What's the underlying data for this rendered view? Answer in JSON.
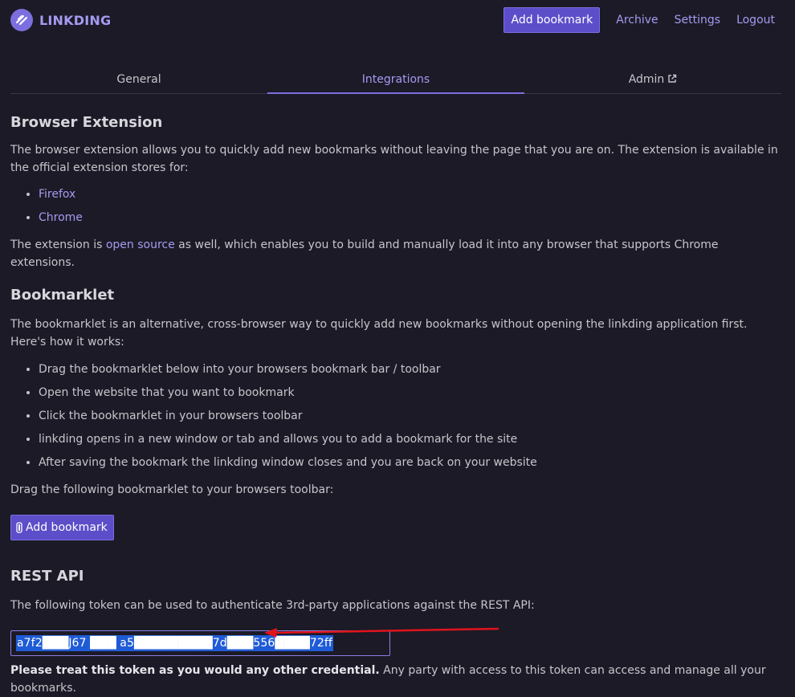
{
  "header": {
    "brand": "LINKDING",
    "add_bookmark_label": "Add bookmark",
    "nav": [
      {
        "label": "Archive"
      },
      {
        "label": "Settings"
      },
      {
        "label": "Logout"
      }
    ]
  },
  "tabs": [
    {
      "label": "General",
      "active": false
    },
    {
      "label": "Integrations",
      "active": true
    },
    {
      "label": "Admin",
      "active": false,
      "icon": "external-link-icon"
    }
  ],
  "browser_extension": {
    "title": "Browser Extension",
    "description": "The browser extension allows you to quickly add new bookmarks without leaving the page that you are on. The extension is available in the official extension stores for:",
    "stores": [
      "Firefox",
      "Chrome"
    ],
    "open_source_prefix": "The extension is ",
    "open_source_link": "open source",
    "open_source_suffix": " as well, which enables you to build and manually load it into any browser that supports Chrome extensions."
  },
  "bookmarklet": {
    "title": "Bookmarklet",
    "description": "The bookmarklet is an alternative, cross-browser way to quickly add new bookmarks without opening the linkding application first. Here's how it works:",
    "steps": [
      "Drag the bookmarklet below into your browsers bookmark bar / toolbar",
      "Open the website that you want to bookmark",
      "Click the bookmarklet in your browsers toolbar",
      "linkding opens in a new window or tab and allows you to add a bookmark for the site",
      "After saving the bookmark the linkding window closes and you are back on your website"
    ],
    "drag_instruction": "Drag the following bookmarklet to your browsers toolbar:",
    "button_label": "Add bookmark",
    "button_icon": "bookmark-icon"
  },
  "rest_api": {
    "title": "REST API",
    "description": "The following token can be used to authenticate 3rd-party applications against the REST API:",
    "token": "a7f2███J67 ███ a5█████████7d███556████72ff",
    "warning_bold": "Please treat this token as you would any other credential.",
    "warning_rest": " Any party with access to this token can access and manage all your bookmarks."
  },
  "colors": {
    "background": "#1c1a26",
    "accent": "#7b6fe0",
    "link": "#a49bf2",
    "selection": "#1f5bd6",
    "annotation_arrow": "#e0141b"
  }
}
